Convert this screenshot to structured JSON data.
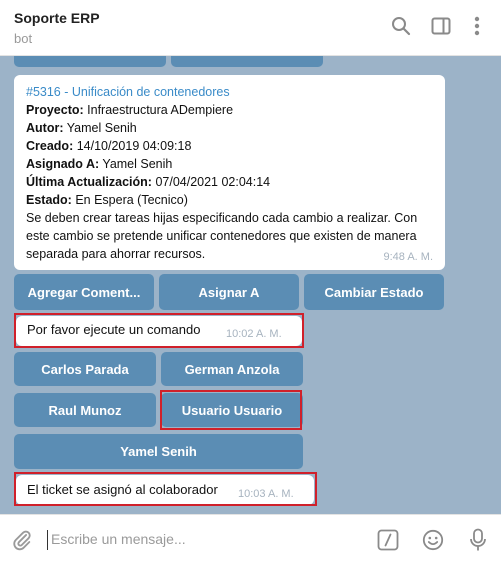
{
  "header": {
    "title": "Soporte ERP",
    "subtitle": "bot",
    "icons": [
      "search-icon",
      "sidebar-toggle-icon",
      "more-vertical-icon"
    ]
  },
  "ticket": {
    "link": "#5316 - Unificación de contenedores",
    "project_label": "Proyecto:",
    "project_value": "Infraestructura ADempiere",
    "author_label": "Autor:",
    "author_value": "Yamel Senih",
    "created_label": "Creado:",
    "created_value": "14/10/2019 04:09:18",
    "assigned_label": "Asignado A:",
    "assigned_value": "Yamel Senih",
    "updated_label": "Última Actualización:",
    "updated_value": "07/04/2021 02:04:14",
    "status_label": "Estado:",
    "status_value": "En Espera (Tecnico)",
    "description": "Se deben crear tareas hijas especificando cada cambio a realizar. Con este cambio se pretende unificar contenedores que existen de manera separada para ahorrar recursos.",
    "time": "9:48 A. M."
  },
  "actions": {
    "add_comment": "Agregar Coment...",
    "assign": "Asignar A",
    "change_status": "Cambiar Estado"
  },
  "msg1": {
    "text": "Por favor ejecute un comando",
    "time": "10:02 A. M."
  },
  "users": {
    "carlos": "Carlos Parada",
    "german": "German Anzola",
    "raul": "Raul Munoz",
    "usuario": "Usuario Usuario",
    "yamel": "Yamel Senih"
  },
  "msg2": {
    "text": "El ticket se asignó al colaborador",
    "time": "10:03 A. M."
  },
  "composer": {
    "placeholder": "Escribe un mensaje...",
    "icons": [
      "attach-icon",
      "bot-command-icon",
      "emoji-icon",
      "microphone-icon"
    ]
  },
  "colors": {
    "accent": "#3a8bc8",
    "keyboard_button": "#5b8db4",
    "chat_background": "#9cb3c8",
    "highlight": "#d0202a"
  }
}
